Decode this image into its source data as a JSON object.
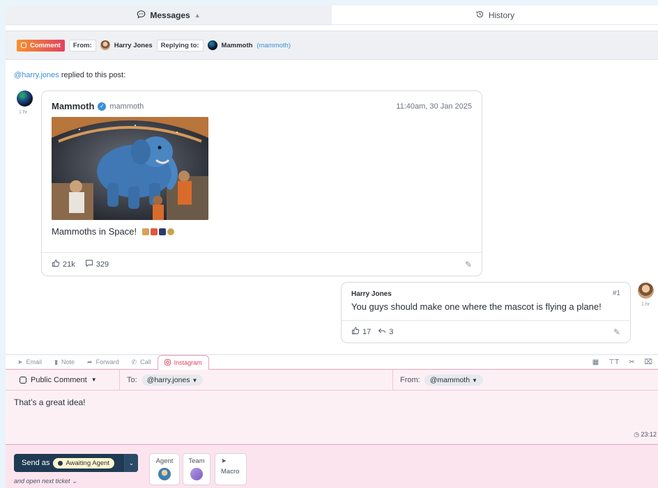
{
  "tabs": {
    "messages": "Messages",
    "history": "History"
  },
  "context": {
    "channel": "Comment",
    "from_label": "From:",
    "from_name": "Harry Jones",
    "replying_label": "Replying to:",
    "replying_name": "Mammoth",
    "replying_handle": "(mammoth)"
  },
  "thread": {
    "replied_mention": "@harry.jones",
    "replied_text": " replied to this post:",
    "left_time": "1 hr",
    "post": {
      "author": "Mammoth",
      "handle": "mammoth",
      "timestamp": "11:40am, 30 Jan 2025",
      "text": "Mammoths in Space!",
      "likes": "21k",
      "comments": "329"
    },
    "reply": {
      "author": "Harry Jones",
      "number": "#1",
      "text": "You guys should make one where the mascot is flying a plane!",
      "likes": "17",
      "shares": "3",
      "time": "1 hr"
    }
  },
  "composer": {
    "tabs": [
      "Email",
      "Note",
      "Forward",
      "Call",
      "Instagram"
    ],
    "type": "Public Comment",
    "to_label": "To:",
    "to_value": "@harry.jones",
    "from_label": "From:",
    "from_value": "@mammoth",
    "body": "That’s a great idea!",
    "timer": "23:12",
    "send_label": "Send as",
    "send_status": "Awaiting Agent",
    "open_next": "and open next ticket",
    "agent_label": "Agent",
    "team_label": "Team",
    "macro_label": "Macro"
  }
}
